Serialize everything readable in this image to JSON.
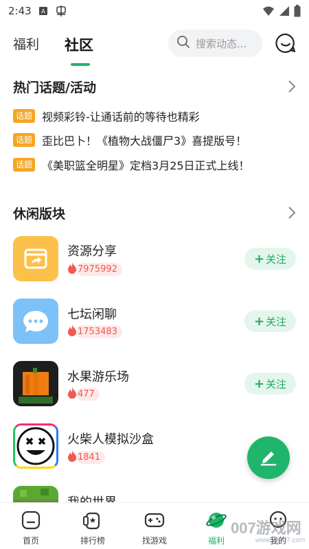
{
  "status_bar": {
    "time": "2:43"
  },
  "header": {
    "tabs": [
      {
        "label": "福利"
      },
      {
        "label": "社区"
      }
    ],
    "active_tab": "社区",
    "search_placeholder": "搜索动态..."
  },
  "hot_topics": {
    "title": "热门话题/活动",
    "badge": "话题",
    "items": [
      {
        "text": "视频彩铃-让通话前的等待也精彩"
      },
      {
        "text": "歪比巴卜！《植物大战僵尸3》喜提版号！"
      },
      {
        "text": "《美职篮全明星》定档3月25日正式上线！"
      }
    ]
  },
  "casual_board": {
    "title": "休闲版块",
    "follow_label": "关注",
    "items": [
      {
        "name": "资源分享",
        "heat": "7975992",
        "icon": "share-folder-icon",
        "color": "#fcc14a"
      },
      {
        "name": "七坛闲聊",
        "heat": "1753483",
        "icon": "chat-bubble-icon",
        "color": "#7cc1f7"
      },
      {
        "name": "水果游乐场",
        "heat": "477",
        "icon": "pumpkin-icon",
        "color": "#1e1e1e"
      },
      {
        "name": "火柴人模拟沙盒",
        "heat": "1841",
        "icon": "stickman-face-icon",
        "color": "#ffffff"
      },
      {
        "name": "我的世界",
        "heat": "",
        "icon": "minecraft-block-icon",
        "color": "#6b8e3a"
      }
    ]
  },
  "bottom_nav": {
    "items": [
      {
        "label": "首页",
        "icon": "home-icon"
      },
      {
        "label": "排行榜",
        "icon": "ranking-icon"
      },
      {
        "label": "找游戏",
        "icon": "gamepad-icon"
      },
      {
        "label": "福利",
        "icon": "planet-icon"
      },
      {
        "label": "我的",
        "icon": "profile-icon"
      }
    ],
    "active": "福利"
  },
  "watermark": {
    "text": "007游戏网",
    "sub": "www.yx007.com"
  },
  "colors": {
    "accent": "#20b36b",
    "badge": "#f5a524",
    "heat": "#ef5a50"
  }
}
